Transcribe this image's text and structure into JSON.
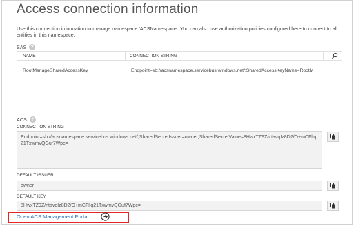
{
  "page": {
    "title": "Access connection information",
    "description": "Use this connection information to manage namespace 'ACSNamespace'. You can also use authorization policies configured here to connect to all entities in this namespace."
  },
  "sas": {
    "label": "SAS",
    "columns": {
      "name": "NAME",
      "connection_string": "CONNECTION STRING"
    },
    "rows": [
      {
        "name": "RootManageSharedAccessKey",
        "connection_string": "Endpoint=sb://acsnamespace.servicebus.windows.net/;SharedAccessKeyName=RootM"
      }
    ]
  },
  "acs": {
    "label": "ACS",
    "connection_string_label": "CONNECTION STRING",
    "connection_string": "Endpoint=sb://acsnamespace.servicebus.windows.net/;SharedSecretIssuer=owner;SharedSecretValue=8HwxTZ9Z/ntavqIz8D2/O+mCFllq21TxwmvQGuf7Wpc=",
    "default_issuer_label": "DEFAULT ISSUER",
    "default_issuer": "owner",
    "default_key_label": "DEFAULT KEY",
    "default_key": "8HwxTZ9Z/ntavqIz8D2/O+mCFllq21TxwmvQGuf7Wpc="
  },
  "portal_link": {
    "label": "Open ACS Management Portal"
  },
  "icons": {
    "help": "help-icon",
    "search": "search-icon",
    "copy": "copy-icon",
    "arrow": "arrow-right-circle-icon"
  },
  "colors": {
    "link": "#2a6fbd",
    "highlight": "#e32626",
    "field_bg": "#f2f2f2"
  }
}
